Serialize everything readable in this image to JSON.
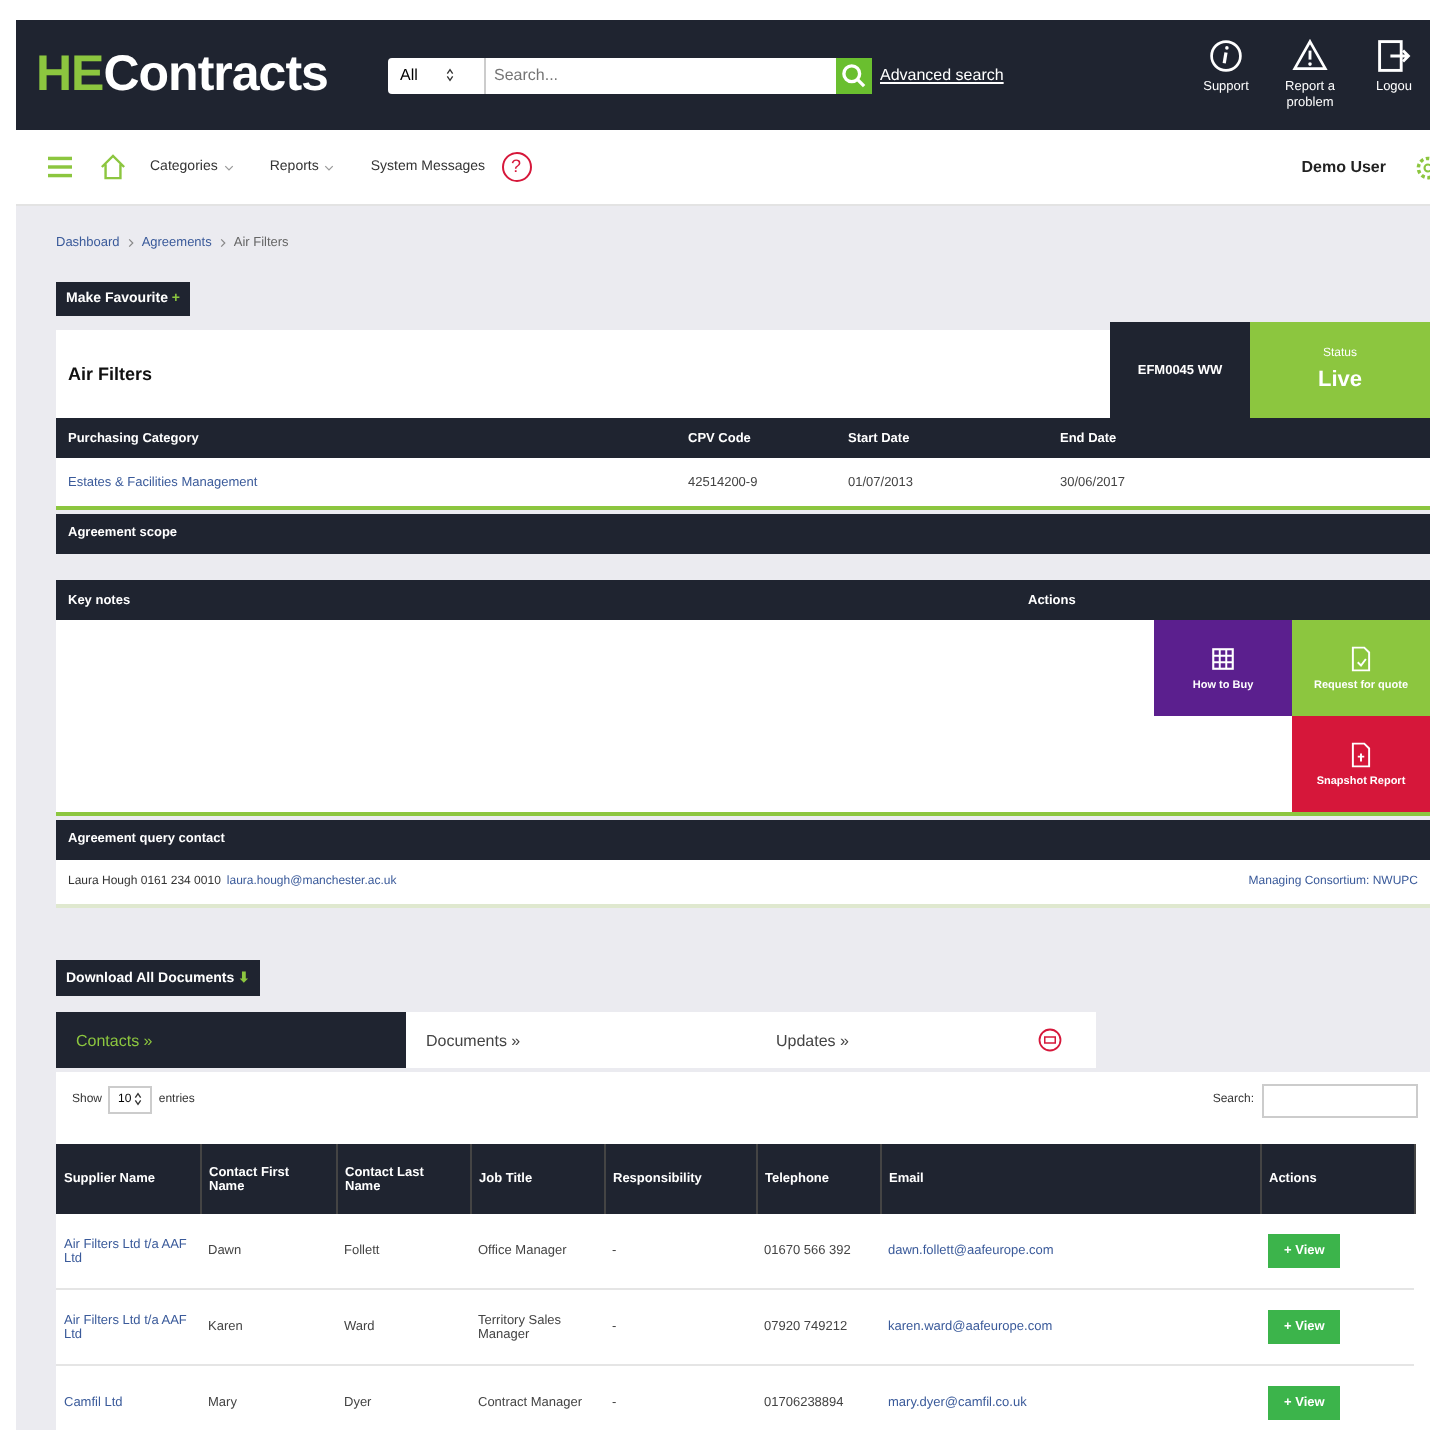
{
  "header": {
    "logo_accent": "HE",
    "logo_rest": "Contracts",
    "scope": "All",
    "search": {
      "placeholder": "Search..."
    },
    "advanced_link": "Advanced search",
    "actions": [
      {
        "kind": "info",
        "label": "Support"
      },
      {
        "kind": "warning",
        "label": "Report a problem"
      },
      {
        "kind": "logout",
        "label": "Logou"
      }
    ]
  },
  "nav": {
    "items": [
      {
        "label": "Categories",
        "dropdown": true
      },
      {
        "label": "Reports",
        "dropdown": true
      },
      {
        "label": "System Messages",
        "dropdown": false
      }
    ],
    "help": "?",
    "user": "Demo User"
  },
  "breadcrumb": [
    "Dashboard",
    "Agreements",
    "Air Filters"
  ],
  "favourite_button": "Make Favourite",
  "favourite_plus": "+",
  "agreement": {
    "title": "Air Filters",
    "reference": "EFM0045 WW",
    "status_label": "Status",
    "status": "Live",
    "columns": [
      "Purchasing Category",
      "CPV Code",
      "Start Date",
      "End Date"
    ],
    "values": [
      "Estates & Facilities Management",
      "42514200-9",
      "01/07/2013",
      "30/06/2017"
    ]
  },
  "scope_heading": "Agreement scope",
  "notes_heading": "Key notes",
  "actions_heading": "Actions",
  "tiles": [
    {
      "kind": "grid",
      "label": "How to Buy",
      "color": "#5b1f8e"
    },
    {
      "kind": "doc",
      "label": "Request for quote",
      "color": "#8cc63f"
    },
    {
      "kind": "report",
      "label": "Snapshot Report",
      "color": "#d6173a"
    }
  ],
  "contact_heading": "Agreement query contact",
  "contact_text": "Laura Hough 0161 234 0010",
  "contact_email": "laura.hough@manchester.ac.uk",
  "consortium": "Managing Consortium: NWUPC",
  "download_button": "Download All Documents",
  "download_arrow": "⬇",
  "tabs": [
    {
      "label": "Contacts »",
      "selected": true
    },
    {
      "label": "Documents »",
      "selected": false
    },
    {
      "label": "Updates »",
      "selected": false
    }
  ],
  "show_label": "Show",
  "page_size": "10",
  "entries_label": "entries",
  "search_label": "Search:",
  "table": {
    "columns": [
      "Supplier Name",
      "Contact First Name",
      "Contact Last Name",
      "Job Title",
      "Responsibility",
      "Telephone",
      "Email",
      "Actions"
    ],
    "rows": [
      {
        "cells": [
          "Air Filters Ltd t/a AAF Ltd",
          "Dawn",
          "Follett",
          "Office Manager",
          "-",
          "01670 566 392",
          "dawn.follett@aafeurope.com"
        ],
        "action": "+ View"
      },
      {
        "cells": [
          "Air Filters Ltd t/a AAF Ltd",
          "Karen",
          "Ward",
          "Territory Sales Manager",
          "-",
          "07920 749212",
          "karen.ward@aafeurope.com"
        ],
        "action": "+ View"
      },
      {
        "cells": [
          "Camfil Ltd",
          "Mary",
          "Dyer",
          "Contract Manager",
          "-",
          "01706238894",
          "mary.dyer@camfil.co.uk"
        ],
        "action": "+ View"
      }
    ]
  }
}
